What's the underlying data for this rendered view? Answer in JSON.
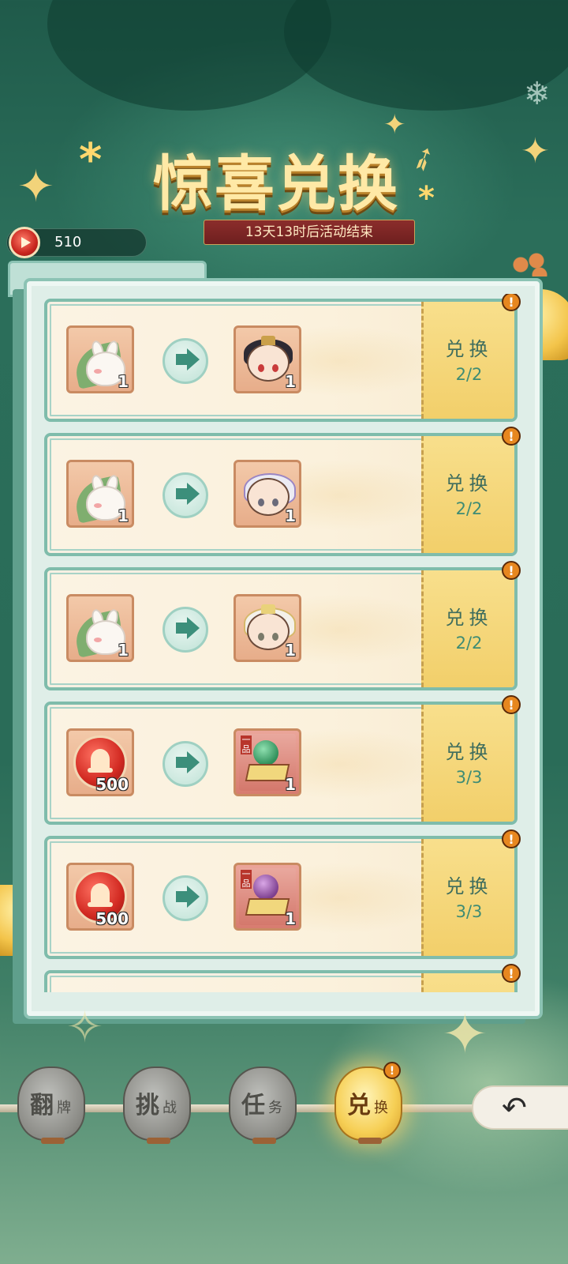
{
  "header": {
    "title": "惊喜兑换",
    "countdown": "13天13时后活动结束"
  },
  "currency": {
    "value": "510",
    "icon": "bell-token-icon"
  },
  "exchange_items": [
    {
      "input": "bunny-leaf",
      "input_count": "1",
      "output": "chibi-dark-hair",
      "output_count": "1",
      "button_label": "兑换",
      "progress": "2/2"
    },
    {
      "input": "bunny-leaf",
      "input_count": "1",
      "output": "chibi-white-hair-purple",
      "output_count": "1",
      "button_label": "兑换",
      "progress": "2/2"
    },
    {
      "input": "bunny-leaf",
      "input_count": "1",
      "output": "chibi-white-hair-gold",
      "output_count": "1",
      "button_label": "兑换",
      "progress": "2/2"
    },
    {
      "input": "bell-coin",
      "input_count": "500",
      "output": "gift-box-green",
      "output_count": "1",
      "rank_label": "一品",
      "button_label": "兑换",
      "progress": "3/3"
    },
    {
      "input": "bell-coin",
      "input_count": "500",
      "output": "gift-box-purple",
      "output_count": "1",
      "rank_label": "一品",
      "button_label": "兑换",
      "progress": "3/3"
    }
  ],
  "alert_glyph": "!",
  "bottom_nav": {
    "tabs": [
      {
        "main": "翻",
        "sub": "牌"
      },
      {
        "main": "挑",
        "sub": "战"
      },
      {
        "main": "任",
        "sub": "务"
      },
      {
        "main": "兑",
        "sub": "换",
        "active": true
      }
    ],
    "back_icon": "back-arrow-icon"
  },
  "colors": {
    "background": "#2a6c58",
    "card": "#fbf1dc",
    "exchange_button": "#f2cf6a",
    "accent_text": "#3f8c74",
    "title_gold": "#ffe9a6",
    "countdown_bg": "#8b2d2b"
  }
}
